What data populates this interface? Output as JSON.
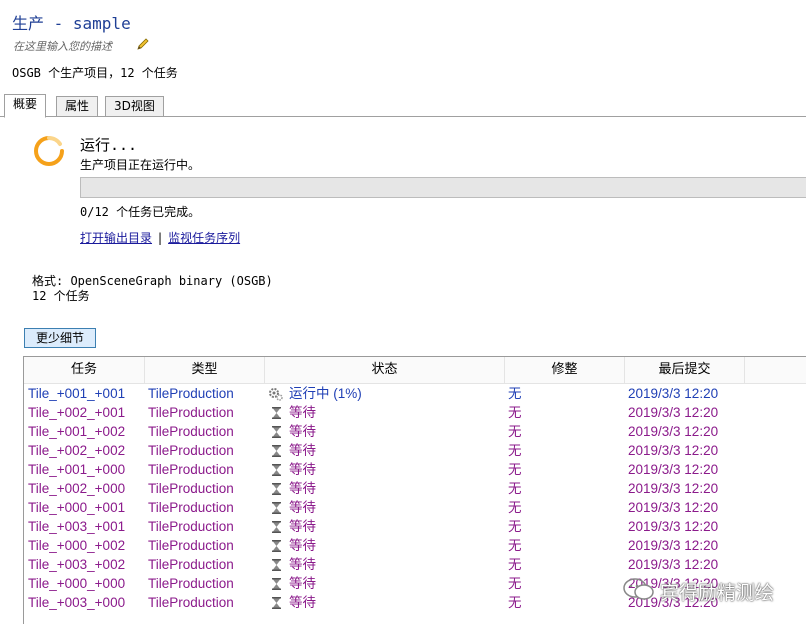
{
  "header": {
    "title": "生产 - sample",
    "description_placeholder": "在这里输入您的描述",
    "summary": "OSGB 个生产项目，12 个任务"
  },
  "tabs": [
    {
      "label": "概要",
      "active": true
    },
    {
      "label": "属性",
      "active": false
    },
    {
      "label": "3D视图",
      "active": false
    }
  ],
  "status": {
    "title": "运行...",
    "subtitle": "生产项目正在运行中。",
    "progress_fraction": 0.0,
    "completed_text": "0/12 个任务已完成。",
    "link_output": "打开输出目录",
    "link_separator": "|",
    "link_monitor": "监视任务序列"
  },
  "details": {
    "format_line": "格式: OpenSceneGraph binary (OSGB)",
    "tasks_line": "12 个任务",
    "less_details_button": "更少细节"
  },
  "table": {
    "columns": [
      "任务",
      "类型",
      "状态",
      "修整",
      "最后提交"
    ],
    "rows": [
      {
        "task": "Tile_+001_+001",
        "type": "TileProduction",
        "status": "运行中 (1%)",
        "running": true,
        "trim": "无",
        "submitted": "2019/3/3 12:20"
      },
      {
        "task": "Tile_+002_+001",
        "type": "TileProduction",
        "status": "等待",
        "running": false,
        "trim": "无",
        "submitted": "2019/3/3 12:20"
      },
      {
        "task": "Tile_+001_+002",
        "type": "TileProduction",
        "status": "等待",
        "running": false,
        "trim": "无",
        "submitted": "2019/3/3 12:20"
      },
      {
        "task": "Tile_+002_+002",
        "type": "TileProduction",
        "status": "等待",
        "running": false,
        "trim": "无",
        "submitted": "2019/3/3 12:20"
      },
      {
        "task": "Tile_+001_+000",
        "type": "TileProduction",
        "status": "等待",
        "running": false,
        "trim": "无",
        "submitted": "2019/3/3 12:20"
      },
      {
        "task": "Tile_+002_+000",
        "type": "TileProduction",
        "status": "等待",
        "running": false,
        "trim": "无",
        "submitted": "2019/3/3 12:20"
      },
      {
        "task": "Tile_+000_+001",
        "type": "TileProduction",
        "status": "等待",
        "running": false,
        "trim": "无",
        "submitted": "2019/3/3 12:20"
      },
      {
        "task": "Tile_+003_+001",
        "type": "TileProduction",
        "status": "等待",
        "running": false,
        "trim": "无",
        "submitted": "2019/3/3 12:20"
      },
      {
        "task": "Tile_+000_+002",
        "type": "TileProduction",
        "status": "等待",
        "running": false,
        "trim": "无",
        "submitted": "2019/3/3 12:20"
      },
      {
        "task": "Tile_+003_+002",
        "type": "TileProduction",
        "status": "等待",
        "running": false,
        "trim": "无",
        "submitted": "2019/3/3 12:20"
      },
      {
        "task": "Tile_+000_+000",
        "type": "TileProduction",
        "status": "等待",
        "running": false,
        "trim": "无",
        "submitted": "2019/3/3 12:20"
      },
      {
        "task": "Tile_+003_+000",
        "type": "TileProduction",
        "status": "等待",
        "running": false,
        "trim": "无",
        "submitted": "2019/3/3 12:20"
      }
    ]
  },
  "watermark": {
    "text": "宾得励精测绘"
  },
  "colors": {
    "running": "#1f3fb5",
    "waiting": "#8b1a8b",
    "title": "#1f3f95",
    "link": "#1a1a9c",
    "spinner": "#f5a11a"
  }
}
